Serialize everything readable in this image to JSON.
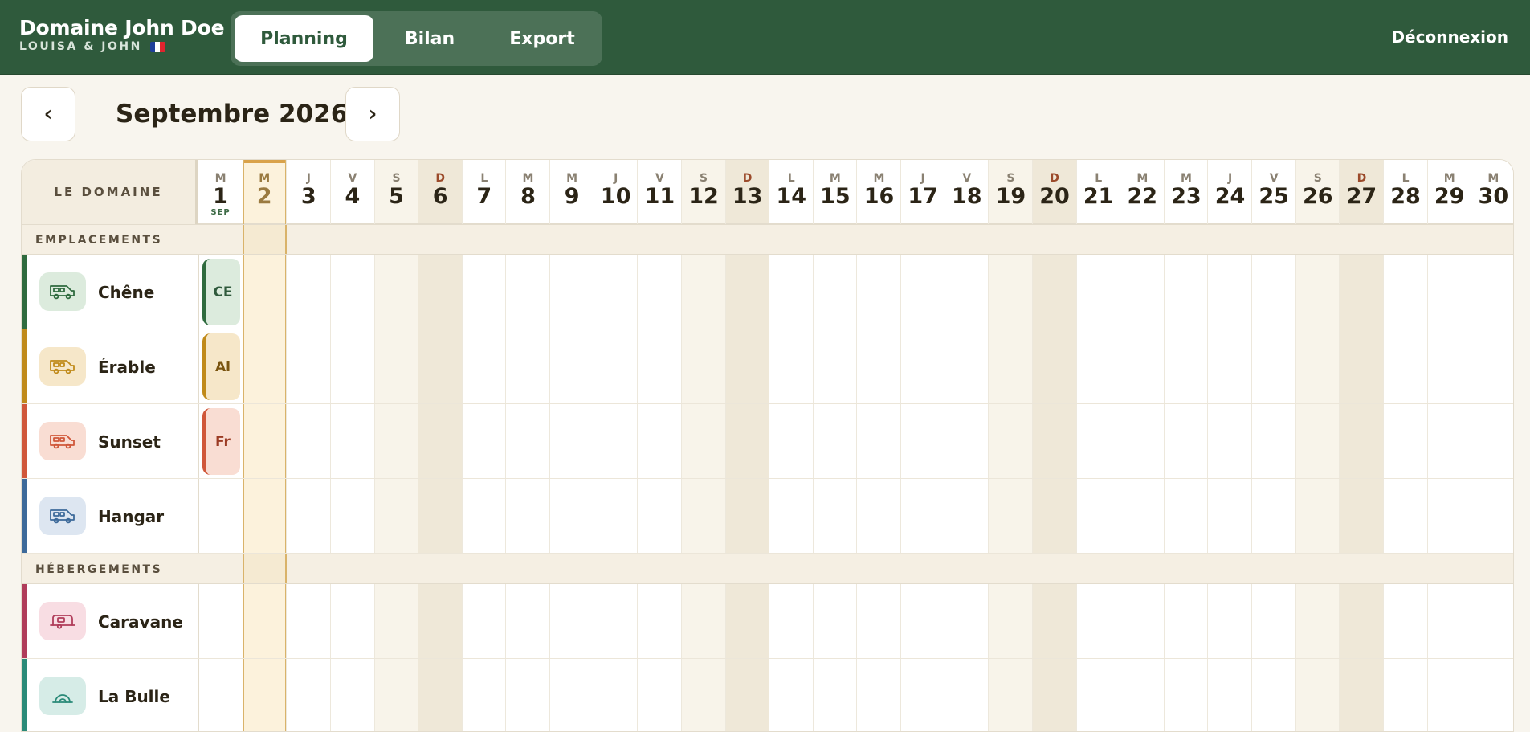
{
  "app": {
    "title": "Domaine John Doe",
    "subtitle": "LOUISA & JOHN"
  },
  "nav": {
    "tabs": [
      {
        "label": "Planning",
        "active": true
      },
      {
        "label": "Bilan",
        "active": false
      },
      {
        "label": "Export",
        "active": false
      }
    ],
    "logout": "Déconnexion"
  },
  "month": {
    "title": "Septembre 2026",
    "prev": "‹",
    "next": "›"
  },
  "grid": {
    "corner_label": "LE DOMAINE",
    "month_abbr": "SEP",
    "today": 2,
    "days": [
      {
        "d": "M",
        "n": "1"
      },
      {
        "d": "M",
        "n": "2"
      },
      {
        "d": "J",
        "n": "3"
      },
      {
        "d": "V",
        "n": "4"
      },
      {
        "d": "S",
        "n": "5"
      },
      {
        "d": "D",
        "n": "6"
      },
      {
        "d": "L",
        "n": "7"
      },
      {
        "d": "M",
        "n": "8"
      },
      {
        "d": "M",
        "n": "9"
      },
      {
        "d": "J",
        "n": "10"
      },
      {
        "d": "V",
        "n": "11"
      },
      {
        "d": "S",
        "n": "12"
      },
      {
        "d": "D",
        "n": "13"
      },
      {
        "d": "L",
        "n": "14"
      },
      {
        "d": "M",
        "n": "15"
      },
      {
        "d": "M",
        "n": "16"
      },
      {
        "d": "J",
        "n": "17"
      },
      {
        "d": "V",
        "n": "18"
      },
      {
        "d": "S",
        "n": "19"
      },
      {
        "d": "D",
        "n": "20"
      },
      {
        "d": "L",
        "n": "21"
      },
      {
        "d": "M",
        "n": "22"
      },
      {
        "d": "M",
        "n": "23"
      },
      {
        "d": "J",
        "n": "24"
      },
      {
        "d": "V",
        "n": "25"
      },
      {
        "d": "S",
        "n": "26"
      },
      {
        "d": "D",
        "n": "27"
      },
      {
        "d": "L",
        "n": "28"
      },
      {
        "d": "M",
        "n": "29"
      },
      {
        "d": "M",
        "n": "30"
      }
    ],
    "sections": [
      {
        "label": "EMPLACEMENTS",
        "resources": [
          {
            "name": "Chêne",
            "icon": "van-icon",
            "color": "#2f6b3e",
            "bg": "#dcebdd",
            "booking": "CE",
            "booking_bg": "#dcebdd",
            "booking_fg": "#2f5a3c"
          },
          {
            "name": "Érable",
            "icon": "van-icon",
            "color": "#c08a1a",
            "bg": "#f6e7c9",
            "booking": "Al",
            "booking_bg": "#f6e7c9",
            "booking_fg": "#7a5410"
          },
          {
            "name": "Sunset",
            "icon": "van-icon",
            "color": "#d0573a",
            "bg": "#f9ddd3",
            "booking": "Fr",
            "booking_bg": "#f9ddd3",
            "booking_fg": "#9b3b24"
          },
          {
            "name": "Hangar",
            "icon": "van-icon",
            "color": "#3d6a9a",
            "bg": "#dde6f1",
            "booking": "",
            "booking_bg": "",
            "booking_fg": ""
          }
        ]
      },
      {
        "label": "HÉBERGEMENTS",
        "resources": [
          {
            "name": "Caravane",
            "icon": "caravan-icon",
            "color": "#b03c5a",
            "bg": "#f8dde3",
            "booking": "",
            "booking_bg": "",
            "booking_fg": ""
          },
          {
            "name": "La Bulle",
            "icon": "bubble-icon",
            "color": "#2a8a78",
            "bg": "#d6ece7",
            "booking": "",
            "booking_bg": "",
            "booking_fg": ""
          }
        ]
      }
    ]
  }
}
